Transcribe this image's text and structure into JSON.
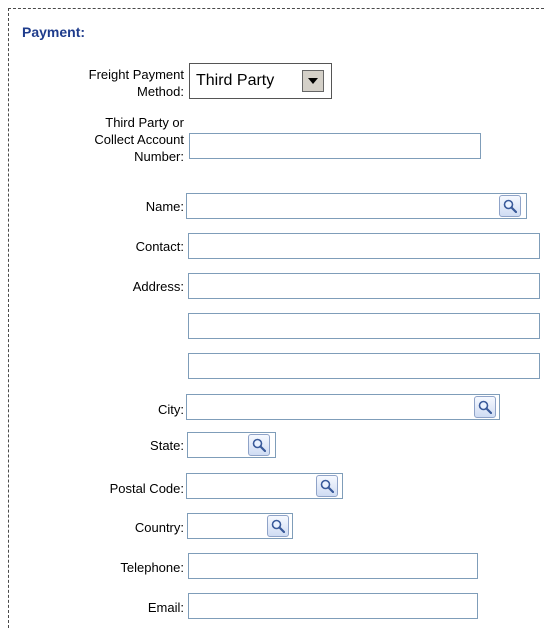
{
  "section": {
    "title": "Payment:"
  },
  "freight": {
    "label_line1": "Freight Payment",
    "label_line2": "Method:",
    "selected": "Third Party",
    "arrow_icon": "dropdown-arrow-icon"
  },
  "account": {
    "label_line1": "Third Party or",
    "label_line2": "Collect Account",
    "label_line3": "Number:",
    "value": ""
  },
  "name": {
    "label": "Name:",
    "value": "",
    "icon": "search-icon"
  },
  "contact": {
    "label": "Contact:",
    "value": ""
  },
  "address": {
    "label": "Address:",
    "line1": "",
    "line2": "",
    "line3": ""
  },
  "city": {
    "label": "City:",
    "value": "",
    "icon": "search-icon"
  },
  "state": {
    "label": "State:",
    "value": "",
    "icon": "search-icon"
  },
  "postal": {
    "label": "Postal Code:",
    "value": "",
    "icon": "search-icon"
  },
  "country": {
    "label": "Country:",
    "value": "",
    "icon": "search-icon"
  },
  "telephone": {
    "label": "Telephone:",
    "value": ""
  },
  "email": {
    "label": "Email:",
    "value": ""
  },
  "colors": {
    "title": "#1f3c8c",
    "input_border": "#7f9db9",
    "frame": "#4a4a4a"
  }
}
